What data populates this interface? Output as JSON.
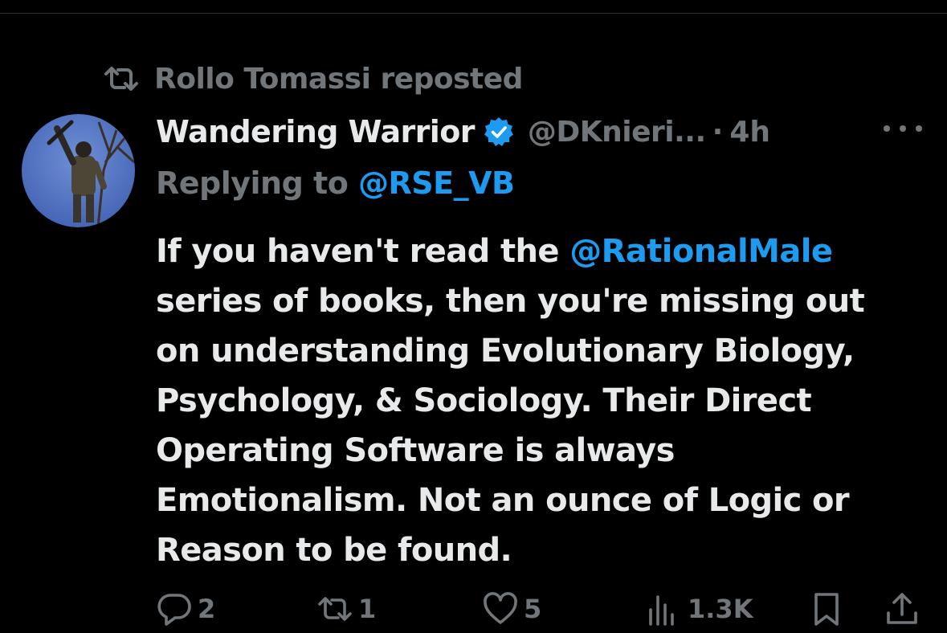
{
  "repost": {
    "icon": "repost-icon",
    "text": "Rollo Tomassi reposted"
  },
  "author": {
    "name": "Wandering Warrior",
    "verified": true,
    "handle": "@DKnieri...",
    "dot": "·",
    "time": "4h"
  },
  "reply": {
    "prefix": "Replying to ",
    "mention": "@RSE_VB"
  },
  "tweet": {
    "line1_pre": "If you haven't read the ",
    "line1_mention": "@RationalMale",
    "lines": [
      "series of books, then you're missing out",
      "on understanding Evolutionary Biology,",
      "Psychology, & Sociology. Their Direct",
      "Operating Software is always",
      "Emotionalism. Not an ounce of Logic or",
      "Reason to be found."
    ]
  },
  "actions": {
    "replies": "2",
    "reposts": "1",
    "likes": "5",
    "views": "1.3K"
  },
  "colors": {
    "background": "#000000",
    "text": "#e7e9ea",
    "muted": "#71767b",
    "link": "#1d9bf0",
    "verified": "#1d9bf0"
  }
}
